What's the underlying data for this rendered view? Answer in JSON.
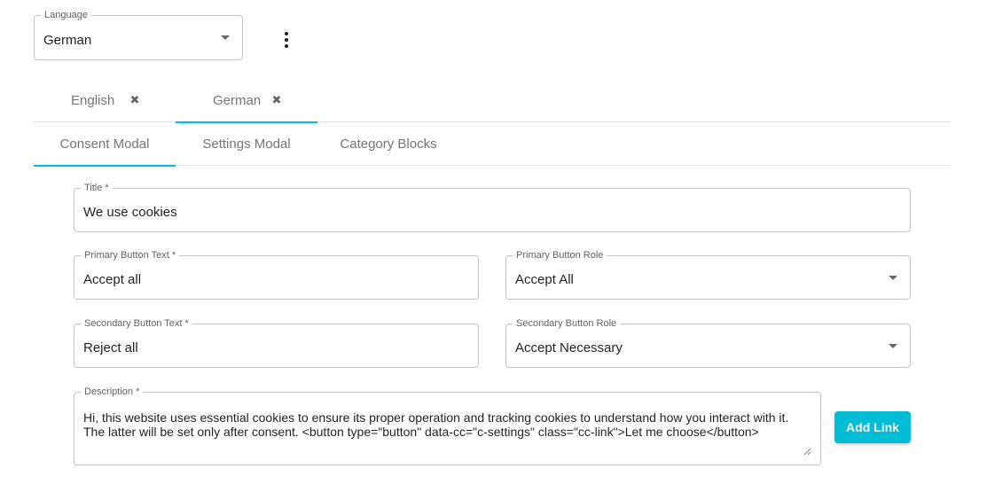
{
  "language_select": {
    "label": "Language",
    "value": "German"
  },
  "language_tabs": [
    {
      "label": "English",
      "close_icon": "close-icon"
    },
    {
      "label": "German",
      "close_icon": "close-icon",
      "active": true
    }
  ],
  "section_tabs": [
    {
      "label": "Consent Modal",
      "active": true
    },
    {
      "label": "Settings Modal"
    },
    {
      "label": "Category Blocks"
    }
  ],
  "form": {
    "title": {
      "label": "Title *",
      "value": "We use cookies"
    },
    "primary_button_text": {
      "label": "Primary Button Text *",
      "value": "Accept all"
    },
    "primary_button_role": {
      "label": "Primary Button Role",
      "value": "Accept All"
    },
    "secondary_button_text": {
      "label": "Secondary Button Text *",
      "value": "Reject all"
    },
    "secondary_button_role": {
      "label": "Secondary Button Role",
      "value": "Accept Necessary"
    },
    "description": {
      "label": "Description *",
      "value": "Hi, this website uses essential cookies to ensure its proper operation and tracking cookies to understand how you interact with it.\nThe latter will be set only after consent. <button type=\"button\" data-cc=\"c-settings\" class=\"cc-link\">Let me choose</button>"
    },
    "add_link_label": "Add Link"
  },
  "colors": {
    "accent": "#00bcd4",
    "border": "#c4c4c4",
    "tab_text": "#757575"
  }
}
